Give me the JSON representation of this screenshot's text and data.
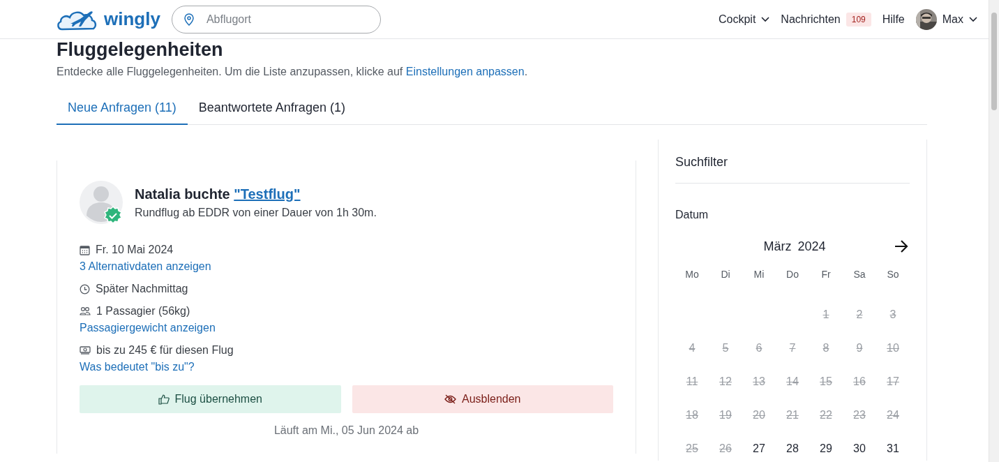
{
  "header": {
    "logo": "wingly",
    "search": {
      "placeholder": "Abflugort"
    },
    "nav": [
      {
        "kind": "menu",
        "label": "Cockpit"
      },
      {
        "kind": "badge",
        "label": "Nachrichten",
        "badge": "109"
      },
      {
        "kind": "link",
        "label": "Hilfe"
      },
      {
        "kind": "user",
        "label": "Max"
      }
    ]
  },
  "page": {
    "title": "Fluggelegenheiten",
    "subtitle": "Entdecke alle Fluggelegenheiten. Um die Liste anzupassen, klicke auf ",
    "subtitle_link": "Einstellungen anpassen",
    "subtitle_end": "."
  },
  "tabs": [
    {
      "label": "Neue Anfragen (11)",
      "selected": true
    },
    {
      "label": "Beantwortete Anfragen (1)",
      "selected": false
    }
  ],
  "request": {
    "name": "Natalia buchte ",
    "flight_link": "\"Testflug\"",
    "verified": true,
    "description": "Rundflug ab EDDR von einer Dauer von 1h 30m.",
    "details": [
      {
        "kind": "date",
        "text": "Fr. 10 Mai 2024",
        "link": "3 Alternativdaten anzeigen"
      },
      {
        "kind": "time",
        "text": "Später Nachmittag"
      },
      {
        "kind": "passengers",
        "text": "1 Passagier (56kg)",
        "link": "Passagiergewicht anzeigen"
      },
      {
        "kind": "price",
        "text": "bis zu 245 € für diesen Flug",
        "link": "Was bedeutet \"bis zu\"?"
      }
    ],
    "buttons": [
      {
        "kind": "accept",
        "label": "Flug übernehmen"
      },
      {
        "kind": "hide",
        "label": "Ausblenden"
      }
    ],
    "expiry": "Läuft am Mi., 05 Jun 2024 ab"
  },
  "filter": {
    "title": "Suchfilter",
    "section": "Datum",
    "calendar": {
      "month": "März",
      "year": "2024",
      "weekdays": [
        "Mo",
        "Di",
        "Mi",
        "Do",
        "Fr",
        "Sa",
        "So"
      ],
      "weeks": [
        [
          {
            "day": "1",
            "disabled": true
          },
          {
            "day": "2",
            "disabled": true
          },
          {
            "day": "3",
            "disabled": true
          }
        ],
        [
          {
            "day": "4",
            "disabled": true
          },
          {
            "day": "5",
            "disabled": true
          },
          {
            "day": "6",
            "disabled": true
          },
          {
            "day": "7",
            "disabled": true
          },
          {
            "day": "8",
            "disabled": true
          },
          {
            "day": "9",
            "disabled": true
          },
          {
            "day": "10",
            "disabled": true
          }
        ],
        [
          {
            "day": "11",
            "disabled": true
          },
          {
            "day": "12",
            "disabled": true
          },
          {
            "day": "13",
            "disabled": true
          },
          {
            "day": "14",
            "disabled": true
          },
          {
            "day": "15",
            "disabled": true
          },
          {
            "day": "16",
            "disabled": true
          },
          {
            "day": "17",
            "disabled": true
          }
        ],
        [
          {
            "day": "18",
            "disabled": true
          },
          {
            "day": "19",
            "disabled": true
          },
          {
            "day": "20",
            "disabled": true
          },
          {
            "day": "21",
            "disabled": true
          },
          {
            "day": "22",
            "disabled": true
          },
          {
            "day": "23",
            "disabled": true
          },
          {
            "day": "24",
            "disabled": true
          }
        ],
        [
          {
            "day": "25",
            "disabled": true
          },
          {
            "day": "26",
            "disabled": true
          },
          {
            "day": "27",
            "disabled": false
          },
          {
            "day": "28",
            "disabled": false
          },
          {
            "day": "29",
            "disabled": false
          },
          {
            "day": "30",
            "disabled": false
          },
          {
            "day": "31",
            "disabled": false
          }
        ]
      ]
    }
  }
}
